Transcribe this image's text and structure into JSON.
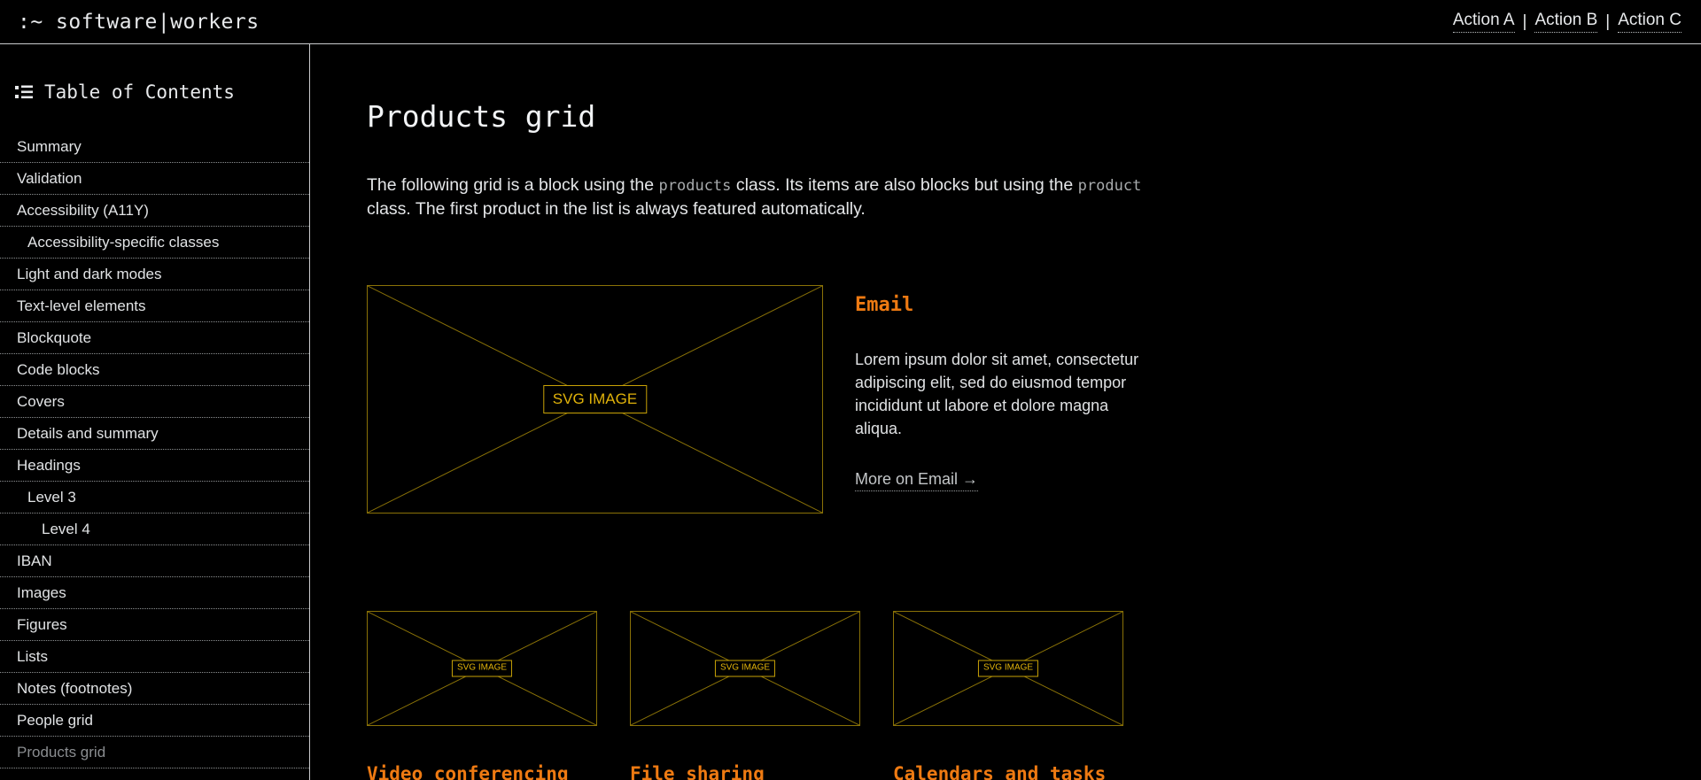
{
  "header": {
    "brand": ":~ software|workers",
    "actions": [
      {
        "label": "Action A"
      },
      {
        "label": "Action B"
      },
      {
        "label": "Action C"
      }
    ],
    "separator": "|"
  },
  "sidebar": {
    "icon": "list-icon",
    "title": "Table of Contents",
    "items": [
      {
        "label": "Summary",
        "level": 1,
        "active": false
      },
      {
        "label": "Validation",
        "level": 1,
        "active": false
      },
      {
        "label": "Accessibility (A11Y)",
        "level": 1,
        "active": false
      },
      {
        "label": "Accessibility-specific classes",
        "level": 2,
        "active": false
      },
      {
        "label": "Light and dark modes",
        "level": 1,
        "active": false
      },
      {
        "label": "Text-level elements",
        "level": 1,
        "active": false
      },
      {
        "label": "Blockquote",
        "level": 1,
        "active": false
      },
      {
        "label": "Code blocks",
        "level": 1,
        "active": false
      },
      {
        "label": "Covers",
        "level": 1,
        "active": false
      },
      {
        "label": "Details and summary",
        "level": 1,
        "active": false
      },
      {
        "label": "Headings",
        "level": 1,
        "active": false
      },
      {
        "label": "Level 3",
        "level": 2,
        "active": false
      },
      {
        "label": "Level 4",
        "level": 3,
        "active": false
      },
      {
        "label": "IBAN",
        "level": 1,
        "active": false
      },
      {
        "label": "Images",
        "level": 1,
        "active": false
      },
      {
        "label": "Figures",
        "level": 1,
        "active": false
      },
      {
        "label": "Lists",
        "level": 1,
        "active": false
      },
      {
        "label": "Notes (footnotes)",
        "level": 1,
        "active": false
      },
      {
        "label": "People grid",
        "level": 1,
        "active": false
      },
      {
        "label": "Products grid",
        "level": 1,
        "active": true
      }
    ]
  },
  "main": {
    "title": "Products grid",
    "intro": {
      "part1": "The following grid is a block using the ",
      "code1": "products",
      "part2": " class. Its items are also blocks but using the ",
      "code2": "product",
      "part3": " class. The first product in the list is always featured automatically."
    },
    "placeholder_label": "SVG IMAGE",
    "featured": {
      "title": "Email",
      "description": "Lorem ipsum dolor sit amet, consectetur adipiscing elit, sed do eiusmod tempor incididunt ut labore et dolore magna aliqua.",
      "link": "More on Email →"
    },
    "products": [
      {
        "title": "Video conferencing"
      },
      {
        "title": "File sharing"
      },
      {
        "title": "Calendars and tasks"
      }
    ]
  },
  "colors": {
    "background": "#000000",
    "text": "#e1e3e5",
    "accent_orange": "#ee7a12",
    "placeholder_border": "#8a7207",
    "placeholder_label": "#e0b20a",
    "muted": "#8a8d90",
    "rule": "#c9cbcd"
  }
}
